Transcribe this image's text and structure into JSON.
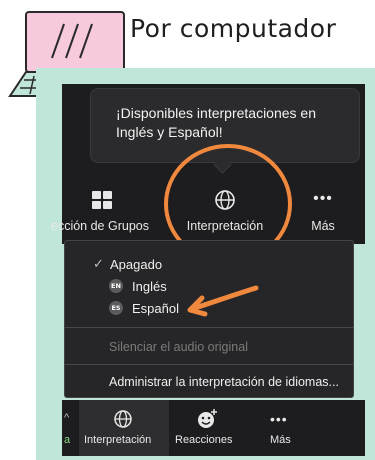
{
  "header": {
    "title": "Por computador"
  },
  "tooltip": {
    "message": "¡Disponibles interpretaciones en Inglés y Español!"
  },
  "toolbar_top": {
    "groups_label": "ección de Grupos",
    "interpretation_label": "Interpretación",
    "more_label": "Más"
  },
  "menu": {
    "off_label": "Apagado",
    "english": {
      "badge": "EN",
      "label": "Inglés"
    },
    "spanish": {
      "badge": "ES",
      "label": "Español"
    },
    "mute_original_label": "Silenciar el audio original",
    "manage_label": "Administrar la interpretación de idiomas..."
  },
  "toolbar_bottom": {
    "left_fragment": "a",
    "interpretation_label": "Interpretación",
    "reactions_label": "Reacciones",
    "more_label": "Más"
  },
  "colors": {
    "accent_orange": "#f0883e",
    "mint": "#bfe6d9",
    "zoom_dark": "#1d1d1f"
  }
}
